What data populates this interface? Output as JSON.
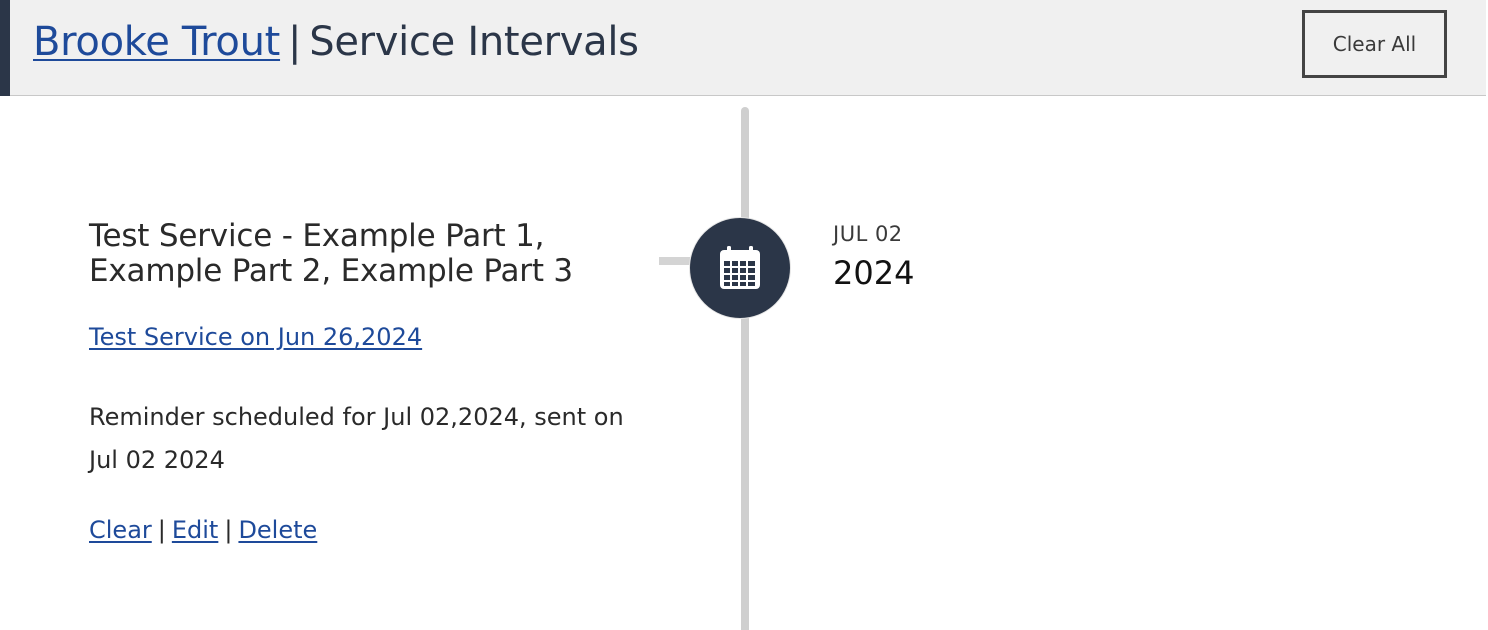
{
  "header": {
    "customer_name": "Brooke Trout",
    "separator": "|",
    "page_title": "Service Intervals",
    "clear_all_label": "Clear All"
  },
  "timeline": {
    "icon": "calendar-icon",
    "entries": [
      {
        "title": "Test Service - Example Part 1, Example Part 2, Example Part 3",
        "service_link": "Test Service on Jun 26,2024",
        "reminder_text": "Reminder scheduled for Jul 02,2024, sent on Jul 02 2024",
        "actions": {
          "clear_label": "Clear",
          "edit_label": "Edit",
          "delete_label": "Delete",
          "separator": "|"
        },
        "date_month_day": "JUL 02",
        "date_year": "2024"
      }
    ]
  },
  "colors": {
    "header_bg": "#f0f0f0",
    "accent_dark": "#2b3648",
    "link": "#1e4a9a",
    "timeline_line": "#cfcfcf"
  }
}
